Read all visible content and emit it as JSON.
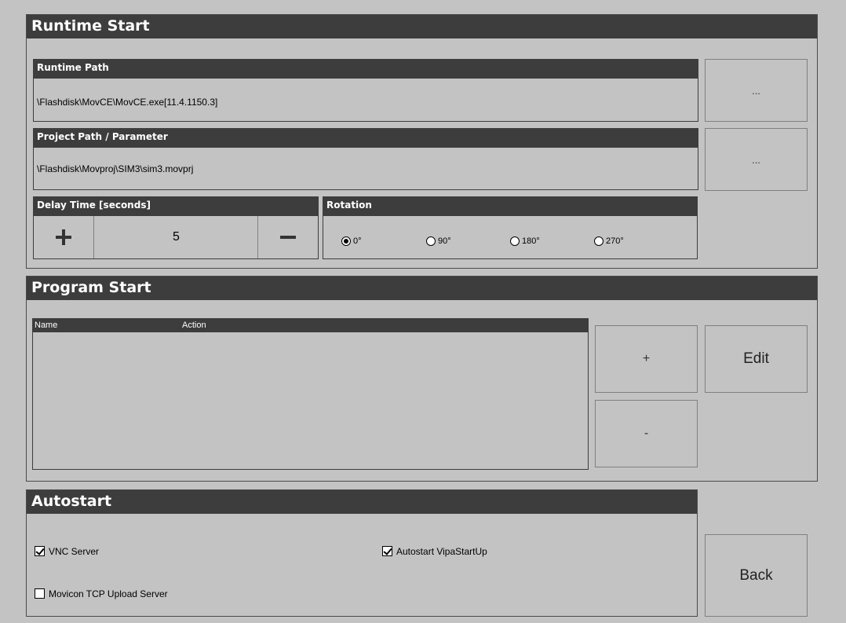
{
  "runtime": {
    "title": "Runtime Start",
    "runtime_path_label": "Runtime Path",
    "runtime_path_value": "\\Flashdisk\\MovCE\\MovCE.exe[11.4.1150.3]",
    "project_path_label": "Project Path / Parameter",
    "project_path_value": "\\Flashdisk\\Movproj\\SIM3\\sim3.movprj",
    "browse_label": "...",
    "delay_label": "Delay Time [seconds]",
    "delay_value": "5",
    "rotation_label": "Rotation",
    "rotation_options": [
      "0°",
      "90°",
      "180°",
      "270°"
    ],
    "rotation_selected": "0°"
  },
  "program": {
    "title": "Program Start",
    "columns": [
      "Name",
      "Action"
    ],
    "add_label": "+",
    "remove_label": "-",
    "edit_label": "Edit"
  },
  "autostart": {
    "title": "Autostart",
    "vnc_label": "VNC Server",
    "vnc_checked": true,
    "vipa_label": "Autostart VipaStartUp",
    "vipa_checked": true,
    "tcp_label": "Movicon TCP Upload Server",
    "tcp_checked": false
  },
  "back_label": "Back"
}
